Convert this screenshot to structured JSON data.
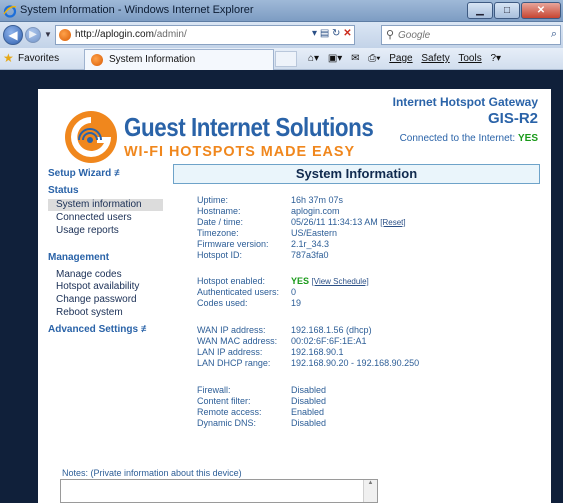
{
  "window": {
    "title": "System Information - Windows Internet Explorer",
    "minimize": "▁",
    "maximize": "□",
    "close": "✕"
  },
  "address": {
    "host": "http://aplogin.com",
    "path": "/admin/"
  },
  "search": {
    "placeholder": "Google"
  },
  "favorites": {
    "label": "Favorites"
  },
  "tab": {
    "label": "System Information"
  },
  "commands": {
    "page": "Page",
    "safety": "Safety",
    "tools": "Tools"
  },
  "header": {
    "brand": "Guest Internet Solutions",
    "tagline": "WI-FI HOTSPOTS MADE EASY",
    "product_line1": "Internet Hotspot Gateway",
    "product_line2": "GIS-R2",
    "connected_label": "Connected to the Internet:",
    "connected_value": "YES"
  },
  "sidebar": {
    "setup_wizard": "Setup Wizard ≢",
    "status_heading": "Status",
    "status_items": [
      "System information",
      "Connected users",
      "Usage reports"
    ],
    "management_heading": "Management",
    "management_items": [
      "Manage codes",
      "Hotspot availability",
      "Change password",
      "Reboot system"
    ],
    "advanced": "Advanced Settings ≢"
  },
  "main": {
    "title": "System Information",
    "uptime": {
      "label": "Uptime:",
      "value": "16h 37m 07s"
    },
    "hostname": {
      "label": "Hostname:",
      "value": "aplogin.com"
    },
    "datetime": {
      "label": "Date / time:",
      "value": "05/26/11 11:34:13 AM",
      "link": "[Reset]"
    },
    "timezone": {
      "label": "Timezone:",
      "value": "US/Eastern"
    },
    "firmware": {
      "label": "Firmware version:",
      "value": "2.1r_34.3"
    },
    "hotspot_id": {
      "label": "Hotspot ID:",
      "value": "787a3fa0"
    },
    "hotspot_enabled": {
      "label": "Hotspot enabled:",
      "value": "YES",
      "link": "[View Schedule]"
    },
    "auth_users": {
      "label": "Authenticated users:",
      "value": "0"
    },
    "codes_used": {
      "label": "Codes used:",
      "value": "19"
    },
    "wan_ip": {
      "label": "WAN IP address:",
      "value": "192.168.1.56 (dhcp)"
    },
    "wan_mac": {
      "label": "WAN MAC address:",
      "value": "00:02:6F:6F:1E:A1"
    },
    "lan_ip": {
      "label": "LAN IP address:",
      "value": "192.168.90.1"
    },
    "lan_dhcp": {
      "label": "LAN DHCP range:",
      "value": "192.168.90.20 - 192.168.90.250"
    },
    "firewall": {
      "label": "Firewall:",
      "value": "Disabled"
    },
    "content_filter": {
      "label": "Content filter:",
      "value": "Disabled"
    },
    "remote_access": {
      "label": "Remote access:",
      "value": "Enabled"
    },
    "dynamic_dns": {
      "label": "Dynamic DNS:",
      "value": "Disabled"
    },
    "notes_label": "Notes: (Private information about this device)"
  }
}
